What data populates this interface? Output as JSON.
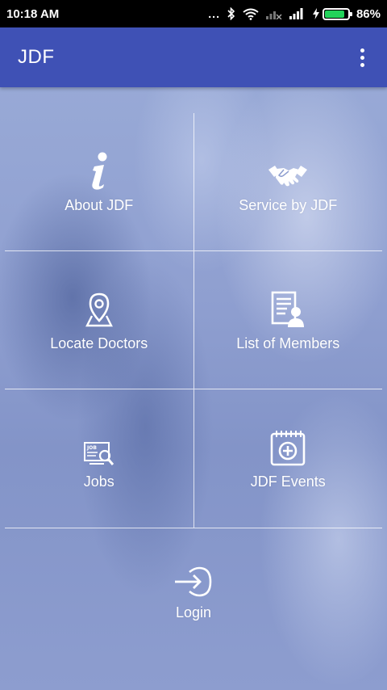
{
  "status_bar": {
    "time": "10:18 AM",
    "dots": "...",
    "battery_percent": "86%",
    "battery_level": 0.86,
    "battery_color": "#22d35a"
  },
  "app_bar": {
    "title": "JDF",
    "color": "#3f51b5"
  },
  "grid": {
    "items": [
      {
        "label": "About JDF",
        "icon": "info-icon"
      },
      {
        "label": "Service by JDF",
        "icon": "handshake-icon"
      },
      {
        "label": "Locate Doctors",
        "icon": "location-pin-icon"
      },
      {
        "label": "List of Members",
        "icon": "member-list-icon"
      },
      {
        "label": "Jobs",
        "icon": "job-icon"
      },
      {
        "label": "JDF Events",
        "icon": "calendar-add-icon"
      }
    ]
  },
  "login": {
    "label": "Login",
    "icon": "login-icon"
  }
}
